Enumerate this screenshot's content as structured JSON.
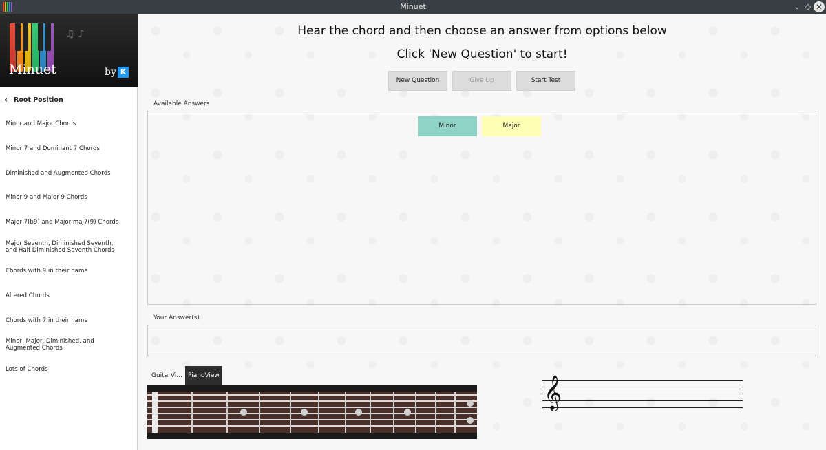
{
  "window": {
    "title": "Minuet"
  },
  "sidebar": {
    "logo": {
      "name": "Minuet",
      "by": "by",
      "kde_mark": "K"
    },
    "back": {
      "label": "Root Position"
    },
    "items": [
      {
        "label": "Minor and Major Chords"
      },
      {
        "label": "Minor 7 and Dominant 7 Chords"
      },
      {
        "label": "Diminished and Augmented Chords"
      },
      {
        "label": "Minor 9 and Major 9 Chords"
      },
      {
        "label": "Major 7(b9) and Major maj7(9) Chords"
      },
      {
        "label": "Major Seventh, Diminished Seventh, and Half Diminished Seventh Chords"
      },
      {
        "label": "Chords with 9 in their name"
      },
      {
        "label": "Altered Chords"
      },
      {
        "label": "Chords with 7 in their name"
      },
      {
        "label": "Minor, Major, Diminished, and Augmented Chords"
      },
      {
        "label": "Lots of Chords"
      }
    ]
  },
  "main": {
    "instruction": "Hear the chord and then choose an answer from options below",
    "prompt": "Click 'New Question' to start!",
    "buttons": {
      "new_question": "New Question",
      "give_up": "Give Up",
      "start_test": "Start Test"
    },
    "available_label": "Available Answers",
    "answers": [
      {
        "label": "Minor",
        "color": "#8fd3c7"
      },
      {
        "label": "Major",
        "color": "#ffffb3"
      }
    ],
    "your_answers_label": "Your Answer(s)",
    "tabs": {
      "guitar": "GuitarVi...",
      "piano": "PianoView"
    }
  },
  "colors": {
    "accent_minor": "#8fd3c7",
    "accent_major": "#ffffb3",
    "titlebar": "#3a3f44"
  }
}
